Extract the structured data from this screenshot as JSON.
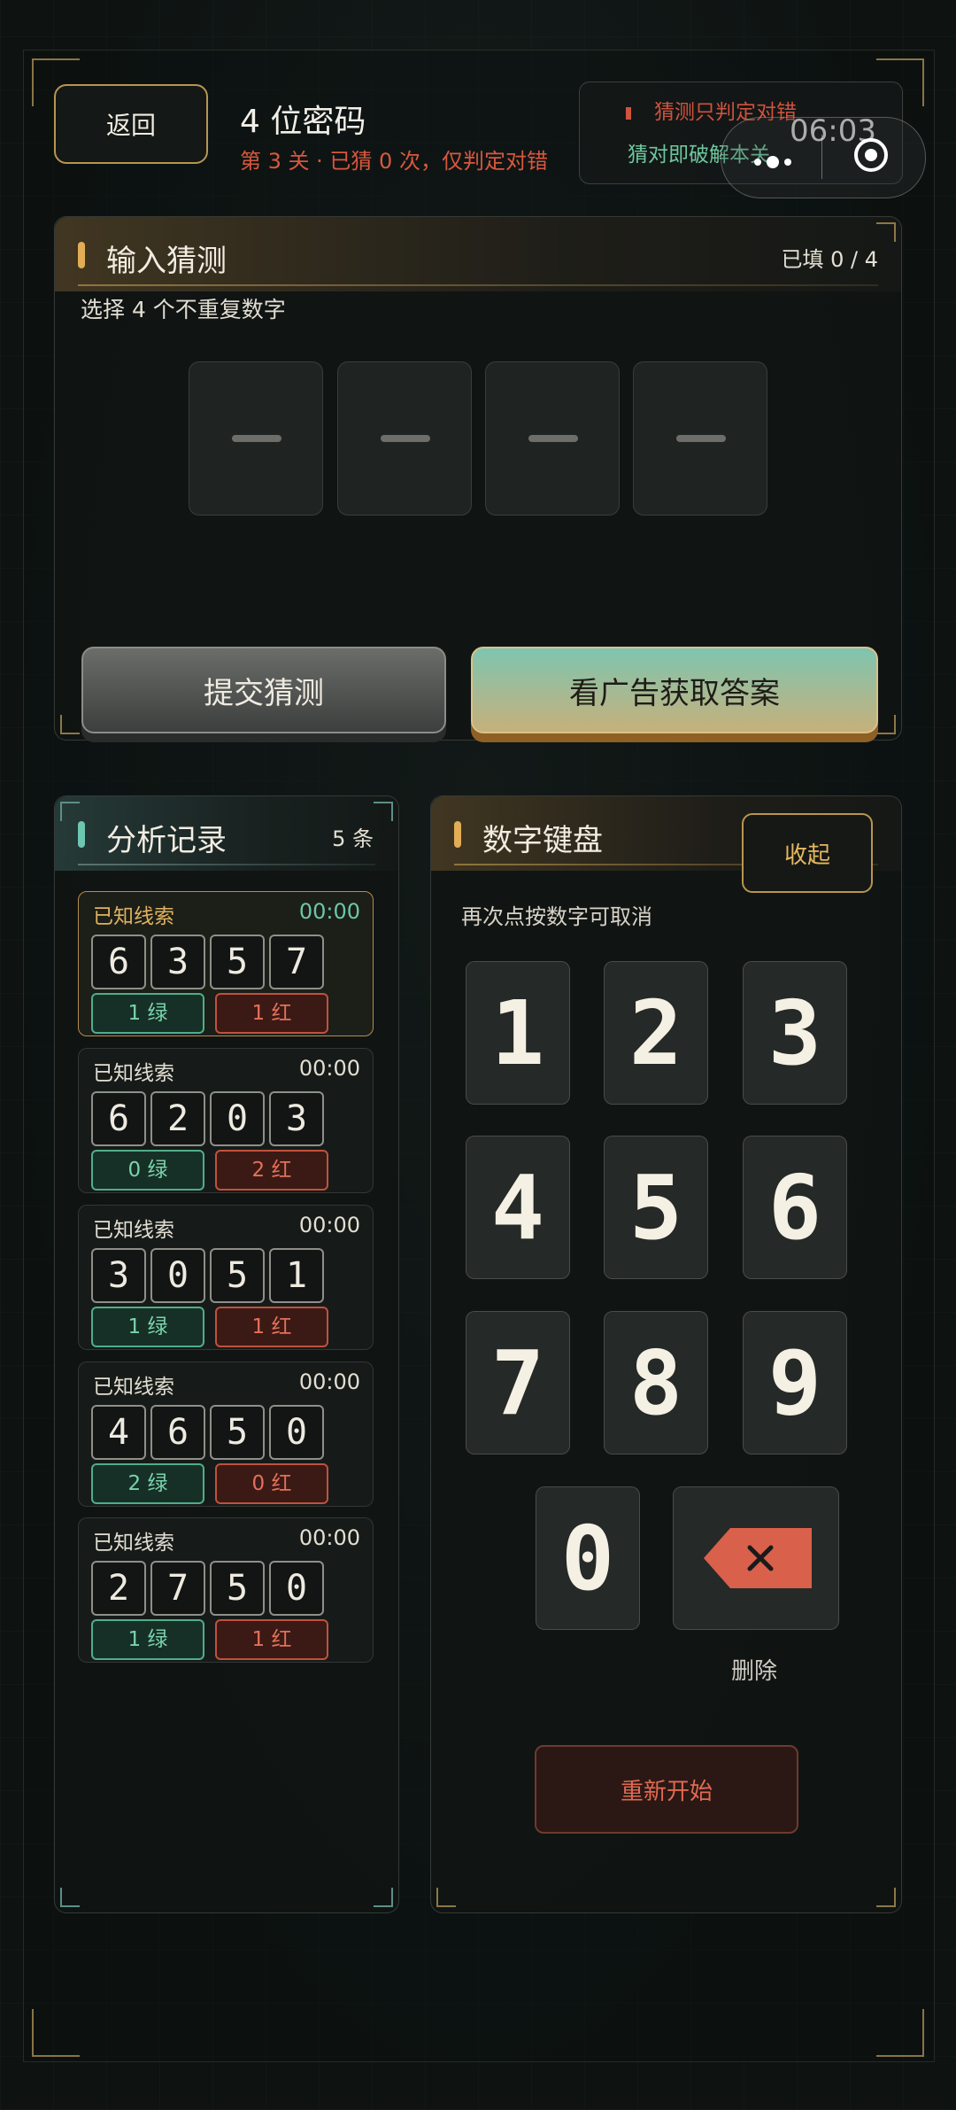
{
  "header": {
    "back_label": "返回",
    "title": "4 位密码",
    "subtitle": "第 3 关 · 已猜 0 次，仅判定对错",
    "hint_line1": "猜测只判定对错",
    "hint_line2": "猜对即破解本关",
    "capsule_time": "06:03"
  },
  "input_panel": {
    "title": "输入猜测",
    "filled": "已填 0 / 4",
    "instruction": "选择 4 个不重复数字",
    "submit_label": "提交猜测",
    "ad_label": "看广告获取答案"
  },
  "records_panel": {
    "title": "分析记录",
    "count": "5 条",
    "records": [
      {
        "label": "已知线索",
        "time": "00:00",
        "digits": [
          "6",
          "3",
          "5",
          "7"
        ],
        "green": "1 绿",
        "red": "1 红"
      },
      {
        "label": "已知线索",
        "time": "00:00",
        "digits": [
          "6",
          "2",
          "0",
          "3"
        ],
        "green": "0 绿",
        "red": "2 红"
      },
      {
        "label": "已知线索",
        "time": "00:00",
        "digits": [
          "3",
          "0",
          "5",
          "1"
        ],
        "green": "1 绿",
        "red": "1 红"
      },
      {
        "label": "已知线索",
        "time": "00:00",
        "digits": [
          "4",
          "6",
          "5",
          "0"
        ],
        "green": "2 绿",
        "red": "0 红"
      },
      {
        "label": "已知线索",
        "time": "00:00",
        "digits": [
          "2",
          "7",
          "5",
          "0"
        ],
        "green": "1 绿",
        "red": "1 红"
      }
    ]
  },
  "keypad_panel": {
    "title": "数字键盘",
    "collapse_label": "收起",
    "hint": "再次点按数字可取消",
    "keys": [
      "1",
      "2",
      "3",
      "4",
      "5",
      "6",
      "7",
      "8",
      "9",
      "0"
    ],
    "delete_label": "删除",
    "restart_label": "重新开始"
  },
  "colors": {
    "accent_gold": "#e2ad55",
    "accent_teal": "#6cc6a8",
    "danger_red": "#d9573e"
  }
}
